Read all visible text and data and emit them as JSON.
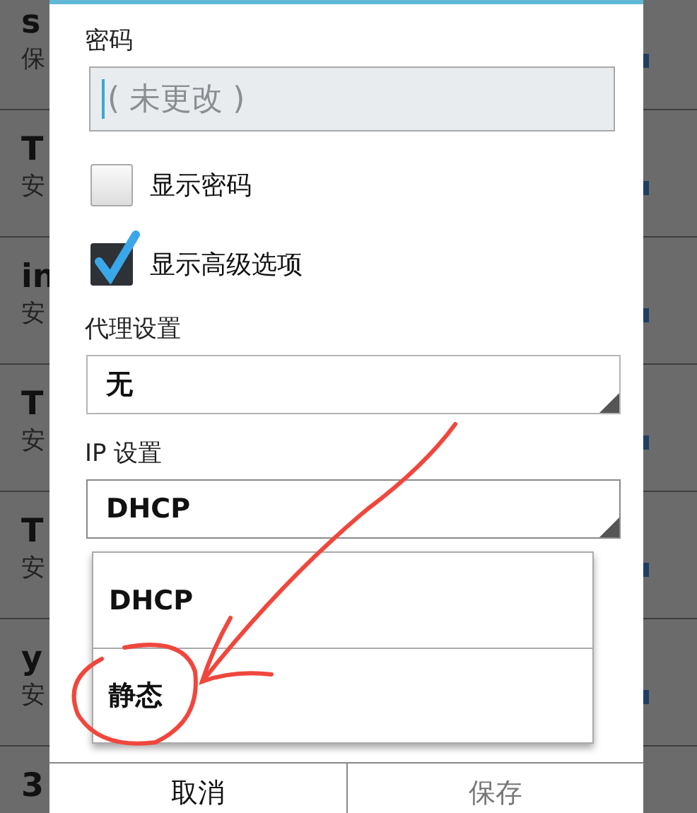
{
  "background_list": [
    {
      "title": "s",
      "subtitle": "保"
    },
    {
      "title": "T",
      "subtitle": "安"
    },
    {
      "title": "in",
      "subtitle": "安"
    },
    {
      "title": "T",
      "subtitle": "安"
    },
    {
      "title": "T",
      "subtitle": "安"
    },
    {
      "title": "y",
      "subtitle": "安"
    },
    {
      "title": "3"
    }
  ],
  "dialog": {
    "password_label": "密码",
    "password_field": {
      "placeholder": "( 未更改 )",
      "focused": true
    },
    "checkboxes": [
      {
        "label": "显示密码",
        "checked": false
      },
      {
        "label": "显示高级选项",
        "checked": true
      }
    ],
    "proxy": {
      "label": "代理设置",
      "value": "无"
    },
    "ip": {
      "label": "IP 设置",
      "value": "DHCP",
      "expanded": true
    },
    "menu": [
      {
        "label": "DHCP"
      },
      {
        "label": "静态"
      }
    ],
    "buttons": [
      "取消",
      "保存"
    ]
  },
  "annotation": {
    "kind": "arrow-circle"
  }
}
